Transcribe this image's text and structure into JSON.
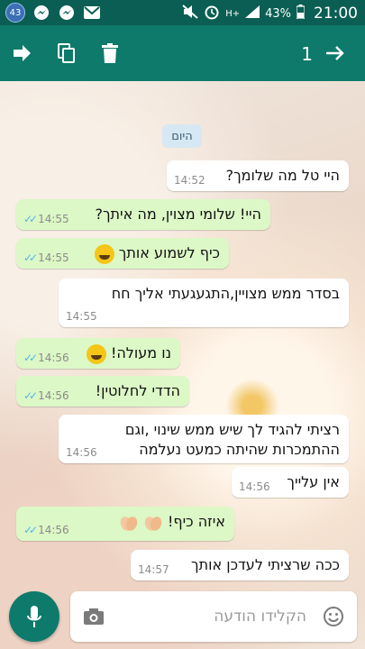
{
  "status_bar": {
    "notification_count": "43",
    "network": "H+",
    "battery": "43%",
    "time": "21:00"
  },
  "action_bar": {
    "selected_count": "1"
  },
  "chat": {
    "date_label": "היום",
    "messages": [
      {
        "text": "היי טל מה שלומך?",
        "time": "14:52",
        "direction": "incoming"
      },
      {
        "text": "היי! שלומי מצוין, מה איתך?",
        "time": "14:55",
        "direction": "outgoing"
      },
      {
        "text": "כיף לשמוע אותך",
        "time": "14:55",
        "direction": "outgoing",
        "emoji": "grinning-face"
      },
      {
        "text": "בסדר ממש מצויין,התגעגעתי אליך חח",
        "time": "14:55",
        "direction": "incoming"
      },
      {
        "text": "נו מעולה!",
        "time": "14:56",
        "direction": "outgoing",
        "emoji": "grinning-face"
      },
      {
        "text": "הדדי לחלוטין!",
        "time": "14:56",
        "direction": "outgoing"
      },
      {
        "text": "רציתי להגיד לך שיש ממש שינוי ,וגם ההתמכרות שהיתה כמעט נעלמה",
        "time": "14:56",
        "direction": "incoming"
      },
      {
        "text": "אין עלייך",
        "time": "14:56",
        "direction": "incoming"
      },
      {
        "text": "איזה כיף!",
        "time": "14:56",
        "direction": "outgoing",
        "emoji": "clapping-hands"
      },
      {
        "text": "ככה שרציתי לעדכן אותך",
        "time": "14:57",
        "direction": "incoming"
      }
    ]
  },
  "composer": {
    "placeholder": "הקלידו הודעה"
  },
  "colors": {
    "header": "#0d7a6b",
    "status_bar": "#0b5e53",
    "outgoing_bubble": "#dcf8c6",
    "incoming_bubble": "#ffffff",
    "read_tick": "#4fb6ec"
  }
}
